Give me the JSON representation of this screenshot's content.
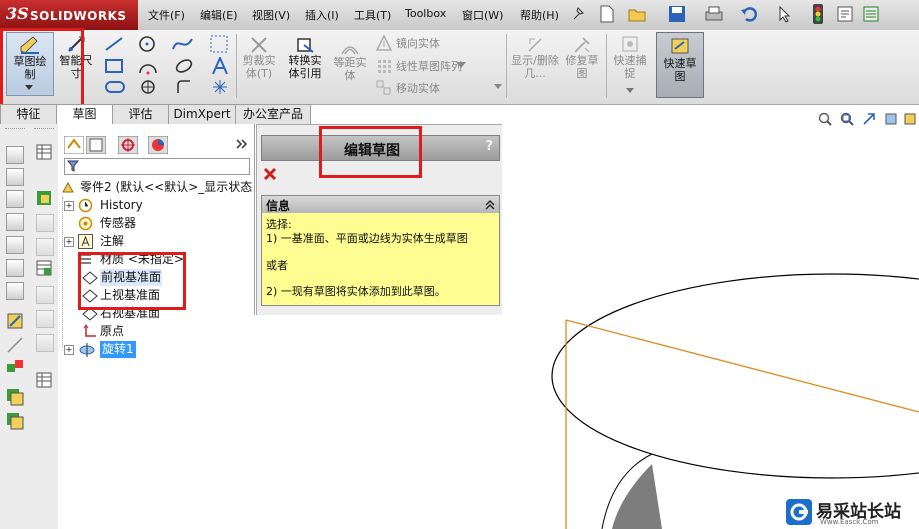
{
  "app": {
    "logo_ds": "3S",
    "logo_name": "SOLIDWORKS"
  },
  "menu": [
    "文件(F)",
    "编辑(E)",
    "视图(V)",
    "插入(I)",
    "工具(T)",
    "Toolbox",
    "窗口(W)",
    "帮助(H)"
  ],
  "ribbon": {
    "sketch": "草图绘制",
    "smart_dim": "智能尺寸",
    "trim": "剪裁实体(T)",
    "convert": "转换实体引用",
    "offset": "等距实体",
    "mirror": "镜向实体",
    "linear_array": "线性草图阵列",
    "move": "移动实体",
    "display_delete": "显示/删除几...",
    "repair": "修复草图",
    "quick_snap": "快速捕捉",
    "rapid_sketch": "快速草图"
  },
  "tabs": [
    "特征",
    "草图",
    "评估",
    "DimXpert",
    "办公室产品"
  ],
  "tree": {
    "root": "零件2 (默认<<默认>_显示状态",
    "items": [
      "History",
      "传感器",
      "注解",
      "材质 <未指定>",
      "前视基准面",
      "上视基准面",
      "右视基准面",
      "原点",
      "旋转1"
    ]
  },
  "pm": {
    "title": "编辑草图",
    "help": "?",
    "info_header": "信息",
    "info_lines": [
      "选择:",
      "1) 一基准面、平面或边线为实体生成草图",
      "或者",
      "2) 一现有草图将实体添加到此草图。"
    ]
  },
  "watermark": {
    "text": "易采站长站",
    "sub": "Www.Easck.Com"
  },
  "colors": {
    "highlight_red": "#e01b1b",
    "tree_select": "#3399ff",
    "info_yellow": "#fdfd92",
    "sketch_orange": "#e08a1e"
  }
}
